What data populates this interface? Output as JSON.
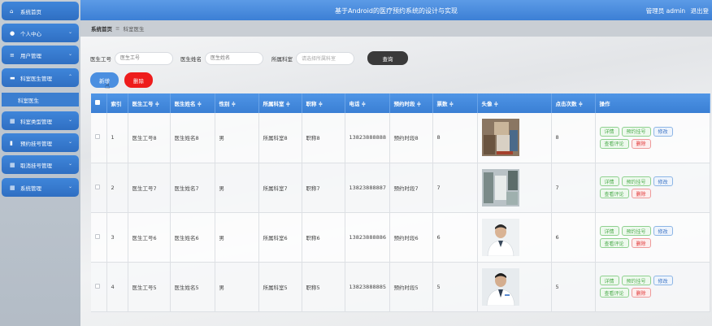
{
  "sidebar": {
    "items": [
      {
        "label": "系统首页",
        "icon": "home-icon"
      },
      {
        "label": "个人中心",
        "icon": "user-icon"
      },
      {
        "label": "用户管理",
        "icon": "list-icon"
      },
      {
        "label": "科室医生管理",
        "icon": "card-icon"
      },
      {
        "label": "科室类型管理",
        "icon": "grid-icon"
      },
      {
        "label": "预约挂号管理",
        "icon": "doc-icon"
      },
      {
        "label": "取消挂号管理",
        "icon": "grid-icon"
      },
      {
        "label": "系统管理",
        "icon": "grid-icon"
      }
    ],
    "active_sub": "科室医生"
  },
  "header": {
    "title": "基于Android的医疗预约系统的设计与实现",
    "user_label": "管理员 admin",
    "logout": "退出登"
  },
  "breadcrumb": {
    "home": "系统首页",
    "separator": "≡",
    "current": "科室医生"
  },
  "search": {
    "doctor_no_label": "医生工号",
    "doctor_no_placeholder": "医生工号",
    "doctor_name_label": "医生姓名",
    "doctor_name_placeholder": "医生姓名",
    "dept_label": "所属科室",
    "dept_placeholder": "请选择所属科室",
    "submit": "查询"
  },
  "actions": {
    "add": "新增",
    "delete": "删除"
  },
  "table": {
    "headers": [
      "索引",
      "医生工号 ≑",
      "医生姓名 ≑",
      "性别 ≑",
      "所属科室 ≑",
      "职称 ≑",
      "电话 ≑",
      "预约时段 ≑",
      "票数 ≑",
      "头像 ≑",
      "点击次数 ≑",
      "操作"
    ],
    "rows": [
      {
        "index": "1",
        "no": "医生工号8",
        "name": "医生姓名8",
        "gender": "男",
        "dept": "所属科室8",
        "title": "职称8",
        "phone": "13823888888",
        "period": "预约时段8",
        "tickets": "8",
        "clicks": "8"
      },
      {
        "index": "2",
        "no": "医生工号7",
        "name": "医生姓名7",
        "gender": "男",
        "dept": "所属科室7",
        "title": "职称7",
        "phone": "13823888887",
        "period": "预约时段7",
        "tickets": "7",
        "clicks": "7"
      },
      {
        "index": "3",
        "no": "医生工号6",
        "name": "医生姓名6",
        "gender": "男",
        "dept": "所属科室6",
        "title": "职称6",
        "phone": "13823888886",
        "period": "预约时段6",
        "tickets": "6",
        "clicks": "6"
      },
      {
        "index": "4",
        "no": "医生工号5",
        "name": "医生姓名5",
        "gender": "男",
        "dept": "所属科室5",
        "title": "职称5",
        "phone": "13823888885",
        "period": "预约时段5",
        "tickets": "5",
        "clicks": "5"
      }
    ],
    "row_ops": {
      "detail": "详情",
      "book": "预约挂号",
      "edit": "修改",
      "comments": "查看评论",
      "delete": "删除"
    }
  },
  "colors": {
    "primary": "#3c7fd5",
    "danger": "#ee1c1c",
    "search_button": "#3a3a3a"
  }
}
